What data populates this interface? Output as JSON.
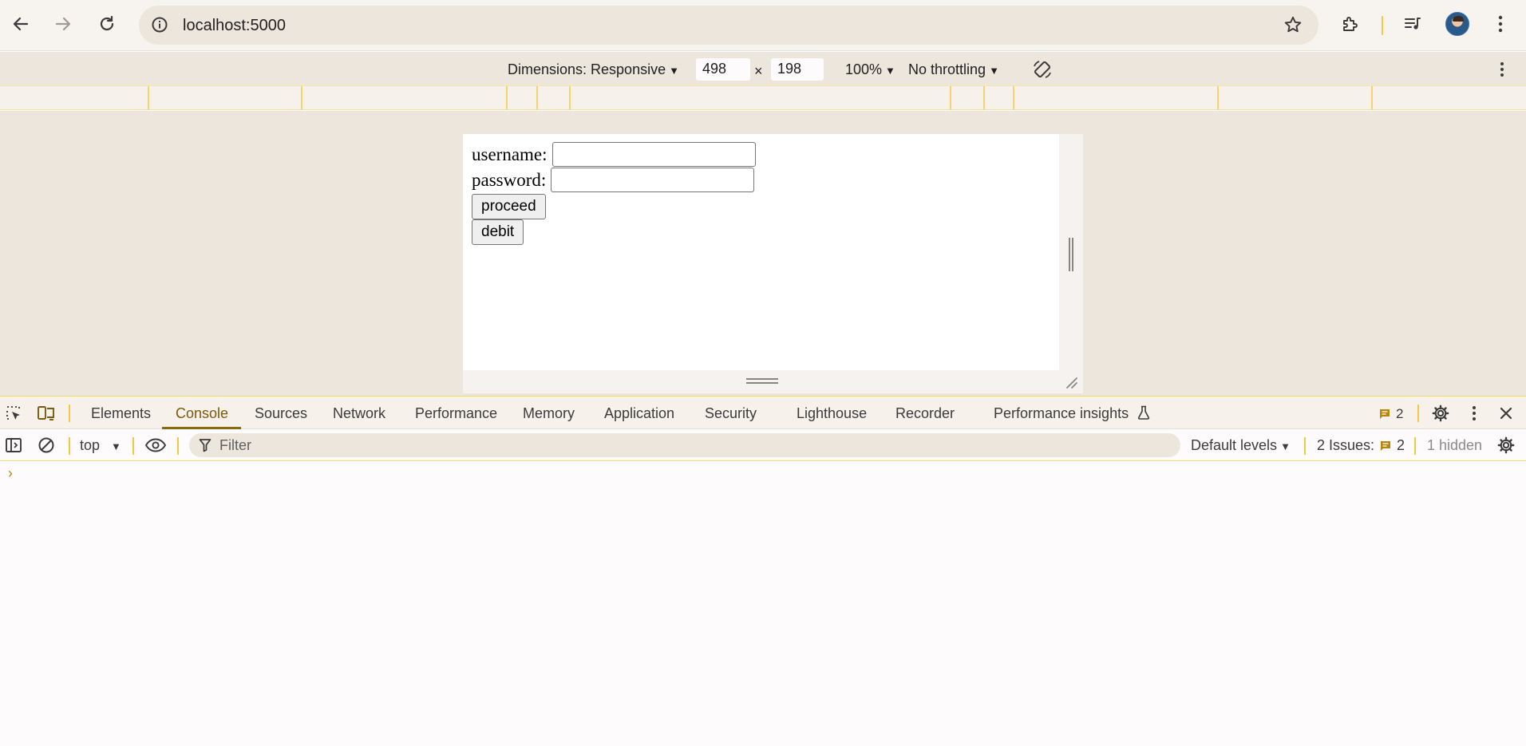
{
  "browser": {
    "url": "localhost:5000"
  },
  "device_toolbar": {
    "dimensions_label": "Dimensions: Responsive",
    "width": "498",
    "height": "198",
    "times": "×",
    "zoom": "100%",
    "throttling": "No throttling"
  },
  "page": {
    "username_label": "username:",
    "password_label": "password:",
    "username_value": "",
    "password_value": "",
    "proceed_label": "proceed",
    "debit_label": "debit"
  },
  "devtools": {
    "tabs": [
      "Elements",
      "Console",
      "Sources",
      "Network",
      "Performance",
      "Memory",
      "Application",
      "Security",
      "Lighthouse",
      "Recorder",
      "Performance insights"
    ],
    "active_tab": "Console",
    "issues_badge_count": "2",
    "console": {
      "context": "top",
      "filter_placeholder": "Filter",
      "levels": "Default levels",
      "issues_label": "2 Issues:",
      "issues_count": "2",
      "hidden": "1 hidden",
      "prompt": "›"
    }
  },
  "colors": {
    "accent": "#8a6a10",
    "separator": "#f5c842",
    "toolbar_bg": "#f7f3ee",
    "panel_bg": "#ede6dd"
  }
}
